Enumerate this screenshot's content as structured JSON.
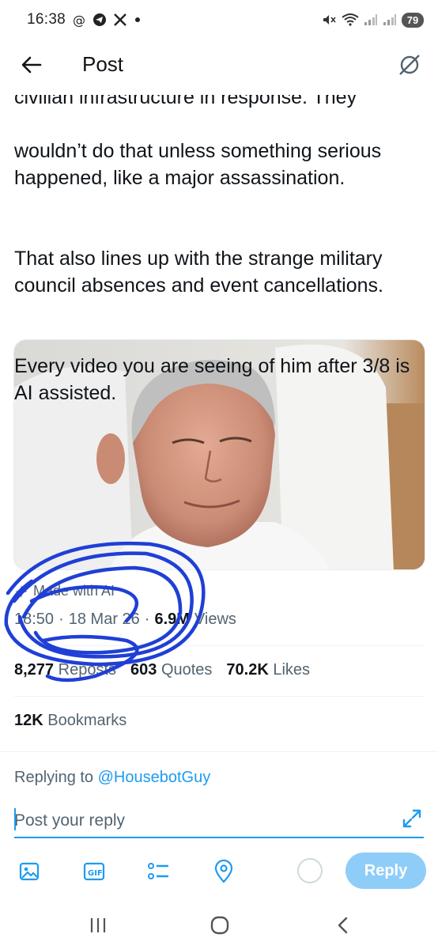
{
  "status_bar": {
    "time": "16:38",
    "battery": "79",
    "icons": [
      "threads-icon",
      "telegram-icon",
      "x-logo-icon",
      "dot-icon",
      "mute-icon",
      "wifi-icon",
      "signal-icon",
      "signal-icon-2"
    ]
  },
  "header": {
    "title": "Post",
    "back_icon": "back-arrow-icon",
    "grok_icon": "grok-icon"
  },
  "tweet": {
    "clipped_line": "civilian infrastructure in response. They",
    "paragraphs": [
      "wouldn’t do that unless something serious happened, like a major assassination.",
      "That also lines up with the strange military council absences and event cancellations.",
      "Every video you are seeing of him after 3/8 is AI assisted."
    ],
    "ai_label": "Made with AI",
    "time": "18:50",
    "date": "18 Mar 26",
    "views_count": "6.9M",
    "views_label": "Views",
    "separator": "·"
  },
  "stats": {
    "reposts_count": "8,277",
    "reposts_label": "Reposts",
    "quotes_count": "603",
    "quotes_label": "Quotes",
    "likes_count": "70.2K",
    "likes_label": "Likes",
    "bookmarks_count": "12K",
    "bookmarks_label": "Bookmarks"
  },
  "reply": {
    "replying_to_label": "Replying to",
    "handle": "@HousebotGuy",
    "placeholder": "Post your reply",
    "button_label": "Reply"
  },
  "colors": {
    "accent": "#1d9bf0",
    "muted": "#536471",
    "reply_button": "#8ecdf8",
    "annotation": "#1f3fd6"
  }
}
